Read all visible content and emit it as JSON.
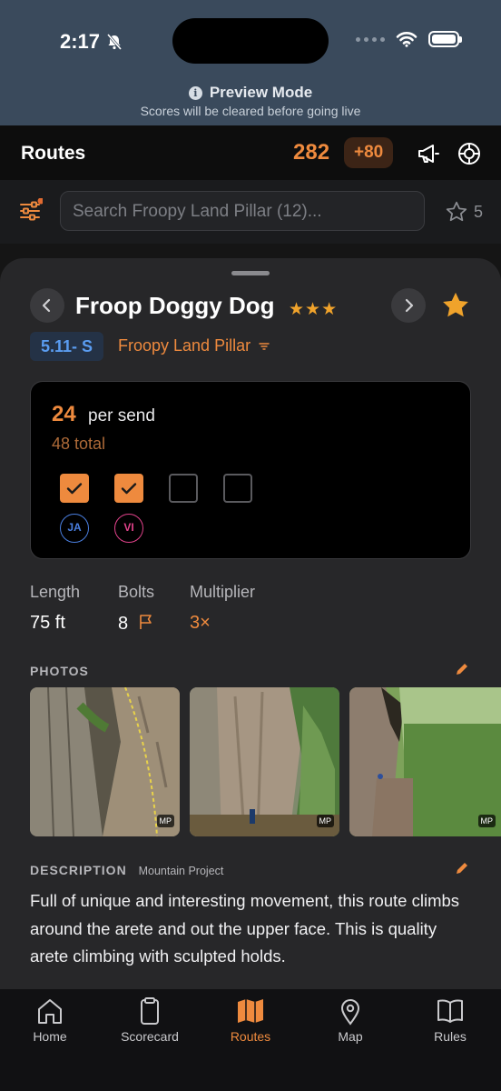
{
  "status": {
    "time": "2:17"
  },
  "preview": {
    "title": "Preview Mode",
    "subtitle": "Scores will be cleared before going live"
  },
  "header": {
    "title": "Routes",
    "score": "282",
    "delta": "+80"
  },
  "search": {
    "placeholder": "Search Froopy Land Pillar (12)...",
    "starred_count": "5"
  },
  "route": {
    "name": "Froop Doggy Dog",
    "stars": "★★★",
    "grade": "5.11- S",
    "area": "Froopy Land Pillar",
    "points": "24",
    "points_label": "per send",
    "total": "48 total",
    "climbers": [
      {
        "initials": "JA",
        "checked": true,
        "color": "#4a7fe0"
      },
      {
        "initials": "VI",
        "checked": true,
        "color": "#e0428a"
      }
    ],
    "stats": [
      {
        "label": "Length",
        "value": "75 ft"
      },
      {
        "label": "Bolts",
        "value": "8"
      },
      {
        "label": "Multiplier",
        "value": "3×"
      }
    ]
  },
  "photos": {
    "heading": "PHOTOS",
    "badge": "MP",
    "count": 3
  },
  "description": {
    "heading": "DESCRIPTION",
    "source": "Mountain Project",
    "text": "Full of unique and interesting movement, this route climbs around the arete and out the upper face. This is quality arete climbing with sculpted holds."
  },
  "tabs": [
    {
      "label": "Home",
      "icon": "home-icon"
    },
    {
      "label": "Scorecard",
      "icon": "clipboard-icon"
    },
    {
      "label": "Routes",
      "icon": "map-folded-icon",
      "active": true
    },
    {
      "label": "Map",
      "icon": "map-pin-icon"
    },
    {
      "label": "Rules",
      "icon": "book-icon"
    }
  ],
  "colors": {
    "accent": "#ee8a3e",
    "grade": "#5a9cf0",
    "star": "#f0a32b"
  }
}
